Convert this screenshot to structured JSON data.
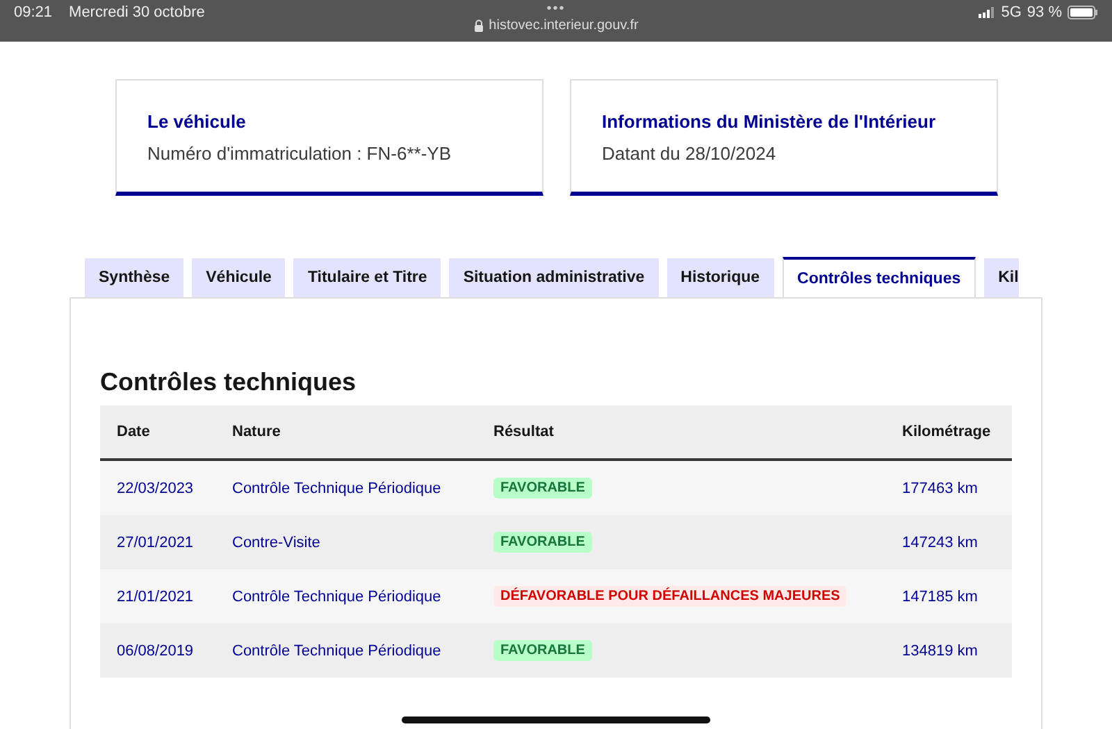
{
  "status_bar": {
    "time": "09:21",
    "date": "Mercredi 30 octobre",
    "dots": "•••",
    "url": "histovec.interieur.gouv.fr",
    "network": "5G",
    "battery": "93 %"
  },
  "cards": [
    {
      "title": "Le véhicule",
      "text": "Numéro d'immatriculation : FN-6**-YB"
    },
    {
      "title": "Informations du Ministère de l'Intérieur",
      "text": "Datant du 28/10/2024"
    }
  ],
  "tabs": [
    {
      "label": "Synthèse",
      "selected": false
    },
    {
      "label": "Véhicule",
      "selected": false
    },
    {
      "label": "Titulaire et Titre",
      "selected": false
    },
    {
      "label": "Situation administrative",
      "selected": false
    },
    {
      "label": "Historique",
      "selected": false
    },
    {
      "label": "Contrôles techniques",
      "selected": true
    },
    {
      "label": "Kil",
      "selected": false
    }
  ],
  "section_title": "Contrôles techniques",
  "table": {
    "columns": [
      "Date",
      "Nature",
      "Résultat",
      "Kilométrage"
    ],
    "rows": [
      {
        "date": "22/03/2023",
        "nature": "Contrôle Technique Périodique",
        "result": {
          "label": "FAVORABLE",
          "kind": "success"
        },
        "mileage": "177463 km"
      },
      {
        "date": "27/01/2021",
        "nature": "Contre-Visite",
        "result": {
          "label": "FAVORABLE",
          "kind": "success"
        },
        "mileage": "147243 km"
      },
      {
        "date": "21/01/2021",
        "nature": "Contrôle Technique Périodique",
        "result": {
          "label": "DÉFAVORABLE POUR DÉFAILLANCES MAJEURES",
          "kind": "error"
        },
        "mileage": "147185 km"
      },
      {
        "date": "06/08/2019",
        "nature": "Contrôle Technique Périodique",
        "result": {
          "label": "FAVORABLE",
          "kind": "success"
        },
        "mileage": "134819 km"
      }
    ]
  }
}
